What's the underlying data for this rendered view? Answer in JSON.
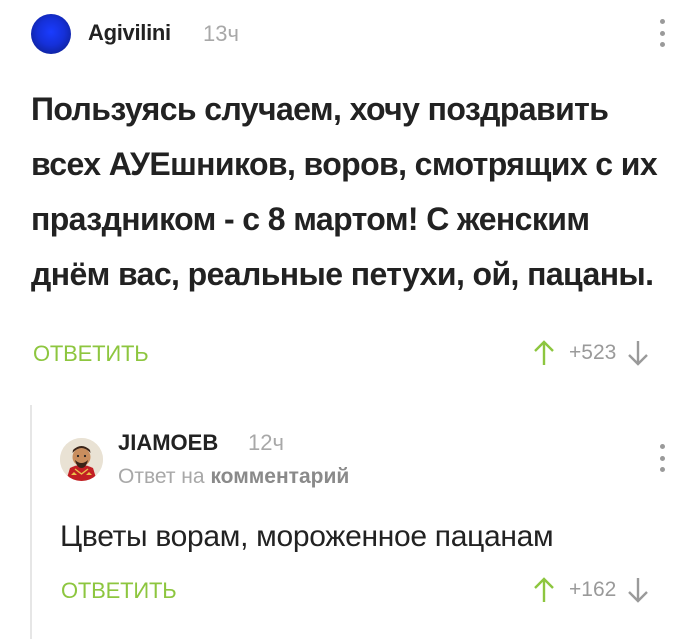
{
  "comment": {
    "author": "Agivilini",
    "time": "13ч",
    "text": "Пользуясь случаем, хочу поздравить всех АУЕшников, воров, смотрящих с их праздником - с 8 мартом! С женским днём вас, реальные петухи, ой, пацаны.",
    "reply_label": "ОТВЕТИТЬ",
    "score": "+523",
    "menu_icon": "kebab-icon",
    "upvote_icon": "arrow-up-icon",
    "downvote_icon": "arrow-down-icon"
  },
  "reply": {
    "author": "JIAMOEB",
    "time": "12ч",
    "reply_prefix": "Ответ на",
    "reply_target": "комментарий",
    "text": "Цветы ворам, мороженное пацанам",
    "reply_label": "ОТВЕТИТЬ",
    "score": "+162"
  },
  "colors": {
    "accent_green": "#8dc63f",
    "muted_gray": "#a8a8a8",
    "text": "#222222",
    "thread_line": "#e6e6e6",
    "avatar_blue": "#1530d8"
  }
}
